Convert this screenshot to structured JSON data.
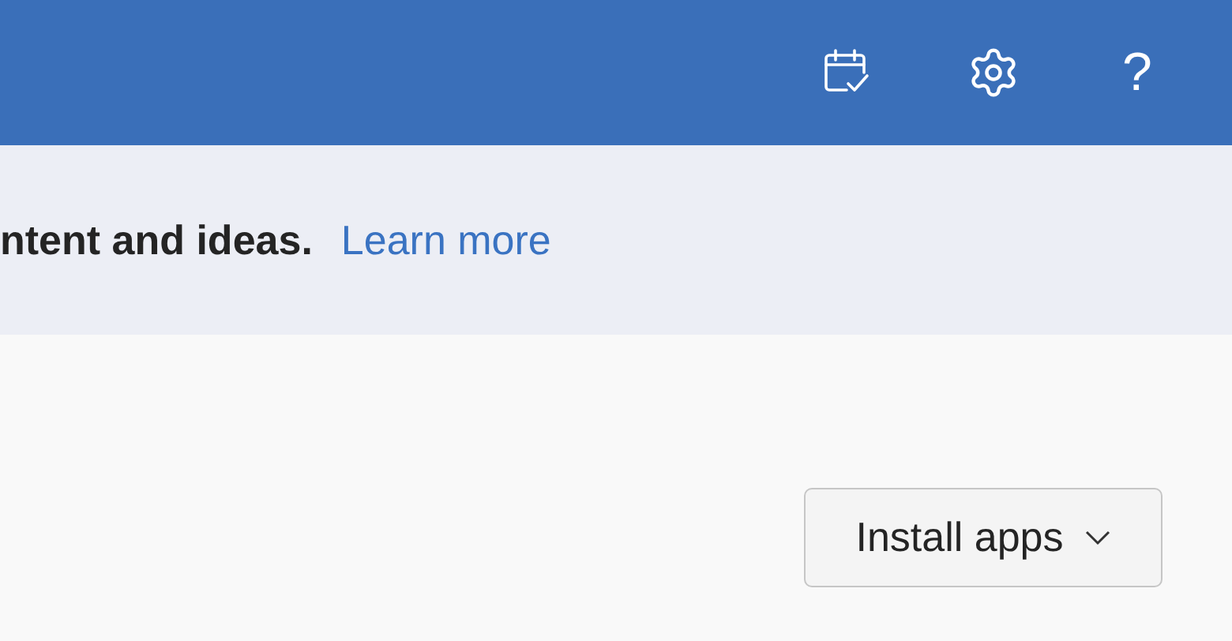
{
  "header": {
    "help_label": "?"
  },
  "banner": {
    "message": "ntent and ideas.",
    "link": "Learn more"
  },
  "install_button": {
    "label": "Install apps"
  }
}
